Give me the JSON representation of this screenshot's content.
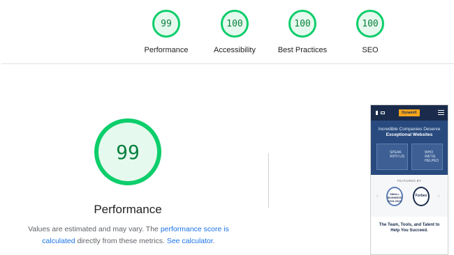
{
  "summary_gauges": [
    {
      "label": "Performance",
      "score": "99"
    },
    {
      "label": "Accessibility",
      "score": "100"
    },
    {
      "label": "Best Practices",
      "score": "100"
    },
    {
      "label": "SEO",
      "score": "100"
    }
  ],
  "performance": {
    "score": "99",
    "title": "Performance",
    "note_part1": "Values are estimated and may vary. The ",
    "link_score": "performance score is calculated",
    "note_part2": " directly from these metrics. ",
    "link_calculator": "See calculator",
    "note_end": "."
  },
  "colors": {
    "pass_ring": "#0cce6b",
    "pass_text": "#08803e",
    "pass_fill": "#e6f9ee",
    "link": "#1a73e8"
  },
  "screenshot": {
    "logo_text": "DynamiX",
    "hero_line1": "Incredible Companies Deserve",
    "hero_line2": "Exceptional Websites",
    "card1": "SPEAK WITH US",
    "card2": "WHO WE'VE HELPED",
    "featured_label": "FEATURED BY",
    "badge1": "SMALL BUSINESS 2019-2023",
    "badge2": "Forbes",
    "tagline": "The Team, Tools, and Talent to Help You Succeed."
  }
}
